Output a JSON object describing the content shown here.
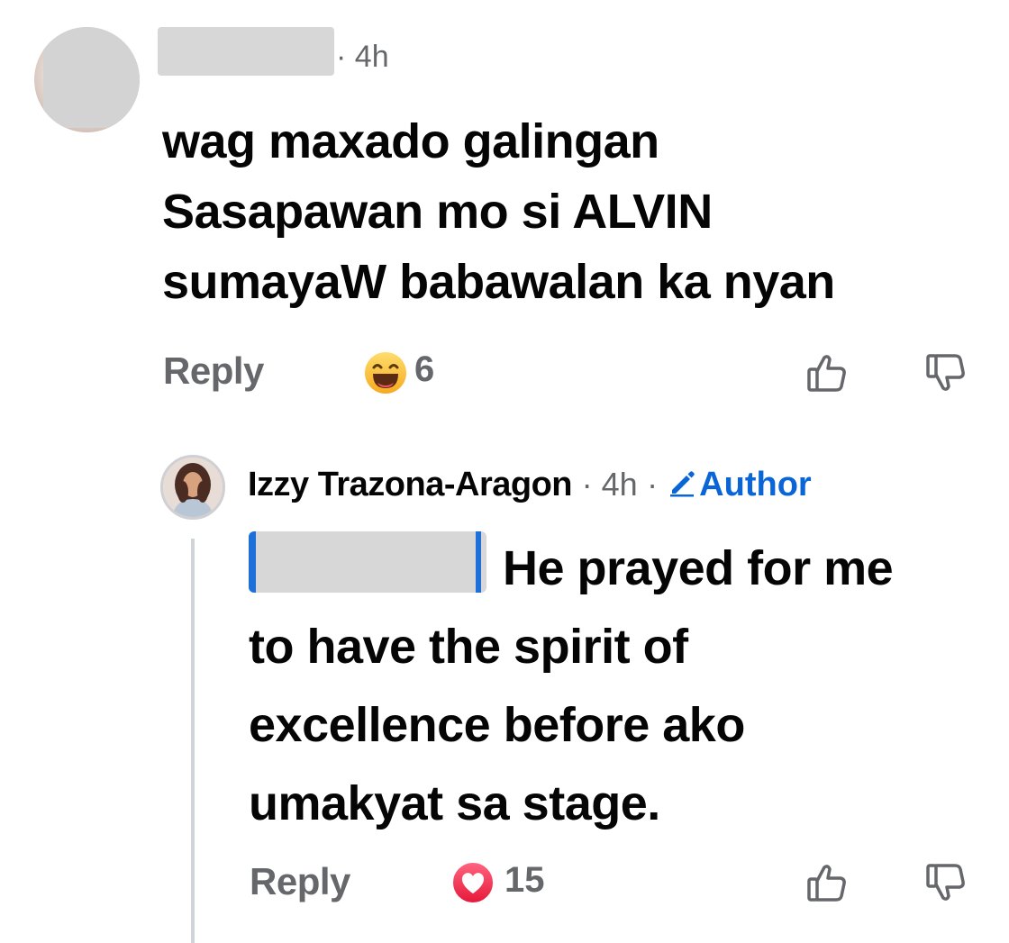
{
  "comment": {
    "time": "4h",
    "lines": [
      "wag maxado galingan",
      "Sasapawan mo si ALVIN",
      "sumayaW babawalan ka nyan"
    ],
    "reply_label": "Reply",
    "reaction_icon": "haha-emoji",
    "reaction_count": "6",
    "like_icon": "thumbs-up-outline",
    "dislike_icon": "thumbs-down-outline",
    "reply": {
      "author_name": "Izzy Trazona-Aragon",
      "time": "4h",
      "badge": "Author",
      "lines": [
        "He prayed for me",
        "to have the spirit of",
        "excellence before ako",
        "umakyat sa stage."
      ],
      "reply_label": "Reply",
      "reaction_icon": "love-heart",
      "reaction_count": "15",
      "like_icon": "thumbs-up-outline",
      "dislike_icon": "thumbs-down-outline"
    }
  },
  "colors": {
    "text_primary": "#050505",
    "text_secondary": "#65676b",
    "author_badge": "#0a66d6",
    "thread_line": "#d0d3d7",
    "redaction": "#d7d7d7",
    "love_red": "#f33e58",
    "haha_yellow": "#f7b125"
  }
}
